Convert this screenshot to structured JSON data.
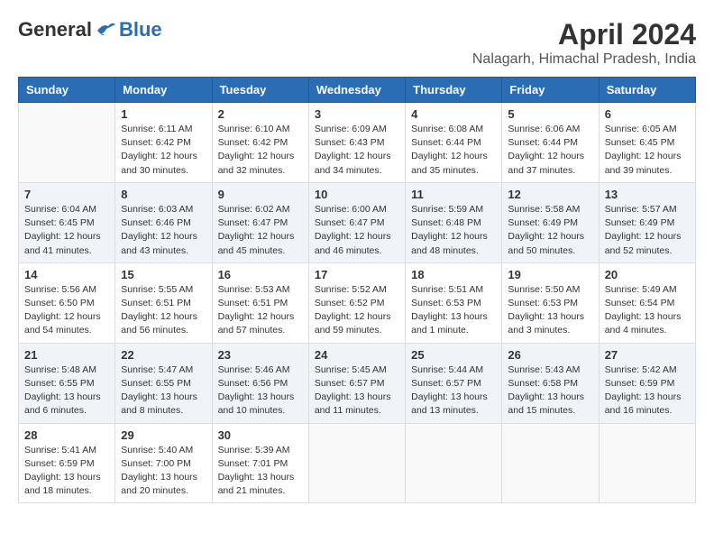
{
  "header": {
    "logo_general": "General",
    "logo_blue": "Blue",
    "title": "April 2024",
    "location": "Nalagarh, Himachal Pradesh, India"
  },
  "days_of_week": [
    "Sunday",
    "Monday",
    "Tuesday",
    "Wednesday",
    "Thursday",
    "Friday",
    "Saturday"
  ],
  "weeks": [
    [
      {
        "day": "",
        "info": ""
      },
      {
        "day": "1",
        "info": "Sunrise: 6:11 AM\nSunset: 6:42 PM\nDaylight: 12 hours\nand 30 minutes."
      },
      {
        "day": "2",
        "info": "Sunrise: 6:10 AM\nSunset: 6:42 PM\nDaylight: 12 hours\nand 32 minutes."
      },
      {
        "day": "3",
        "info": "Sunrise: 6:09 AM\nSunset: 6:43 PM\nDaylight: 12 hours\nand 34 minutes."
      },
      {
        "day": "4",
        "info": "Sunrise: 6:08 AM\nSunset: 6:44 PM\nDaylight: 12 hours\nand 35 minutes."
      },
      {
        "day": "5",
        "info": "Sunrise: 6:06 AM\nSunset: 6:44 PM\nDaylight: 12 hours\nand 37 minutes."
      },
      {
        "day": "6",
        "info": "Sunrise: 6:05 AM\nSunset: 6:45 PM\nDaylight: 12 hours\nand 39 minutes."
      }
    ],
    [
      {
        "day": "7",
        "info": "Sunrise: 6:04 AM\nSunset: 6:45 PM\nDaylight: 12 hours\nand 41 minutes."
      },
      {
        "day": "8",
        "info": "Sunrise: 6:03 AM\nSunset: 6:46 PM\nDaylight: 12 hours\nand 43 minutes."
      },
      {
        "day": "9",
        "info": "Sunrise: 6:02 AM\nSunset: 6:47 PM\nDaylight: 12 hours\nand 45 minutes."
      },
      {
        "day": "10",
        "info": "Sunrise: 6:00 AM\nSunset: 6:47 PM\nDaylight: 12 hours\nand 46 minutes."
      },
      {
        "day": "11",
        "info": "Sunrise: 5:59 AM\nSunset: 6:48 PM\nDaylight: 12 hours\nand 48 minutes."
      },
      {
        "day": "12",
        "info": "Sunrise: 5:58 AM\nSunset: 6:49 PM\nDaylight: 12 hours\nand 50 minutes."
      },
      {
        "day": "13",
        "info": "Sunrise: 5:57 AM\nSunset: 6:49 PM\nDaylight: 12 hours\nand 52 minutes."
      }
    ],
    [
      {
        "day": "14",
        "info": "Sunrise: 5:56 AM\nSunset: 6:50 PM\nDaylight: 12 hours\nand 54 minutes."
      },
      {
        "day": "15",
        "info": "Sunrise: 5:55 AM\nSunset: 6:51 PM\nDaylight: 12 hours\nand 56 minutes."
      },
      {
        "day": "16",
        "info": "Sunrise: 5:53 AM\nSunset: 6:51 PM\nDaylight: 12 hours\nand 57 minutes."
      },
      {
        "day": "17",
        "info": "Sunrise: 5:52 AM\nSunset: 6:52 PM\nDaylight: 12 hours\nand 59 minutes."
      },
      {
        "day": "18",
        "info": "Sunrise: 5:51 AM\nSunset: 6:53 PM\nDaylight: 13 hours\nand 1 minute."
      },
      {
        "day": "19",
        "info": "Sunrise: 5:50 AM\nSunset: 6:53 PM\nDaylight: 13 hours\nand 3 minutes."
      },
      {
        "day": "20",
        "info": "Sunrise: 5:49 AM\nSunset: 6:54 PM\nDaylight: 13 hours\nand 4 minutes."
      }
    ],
    [
      {
        "day": "21",
        "info": "Sunrise: 5:48 AM\nSunset: 6:55 PM\nDaylight: 13 hours\nand 6 minutes."
      },
      {
        "day": "22",
        "info": "Sunrise: 5:47 AM\nSunset: 6:55 PM\nDaylight: 13 hours\nand 8 minutes."
      },
      {
        "day": "23",
        "info": "Sunrise: 5:46 AM\nSunset: 6:56 PM\nDaylight: 13 hours\nand 10 minutes."
      },
      {
        "day": "24",
        "info": "Sunrise: 5:45 AM\nSunset: 6:57 PM\nDaylight: 13 hours\nand 11 minutes."
      },
      {
        "day": "25",
        "info": "Sunrise: 5:44 AM\nSunset: 6:57 PM\nDaylight: 13 hours\nand 13 minutes."
      },
      {
        "day": "26",
        "info": "Sunrise: 5:43 AM\nSunset: 6:58 PM\nDaylight: 13 hours\nand 15 minutes."
      },
      {
        "day": "27",
        "info": "Sunrise: 5:42 AM\nSunset: 6:59 PM\nDaylight: 13 hours\nand 16 minutes."
      }
    ],
    [
      {
        "day": "28",
        "info": "Sunrise: 5:41 AM\nSunset: 6:59 PM\nDaylight: 13 hours\nand 18 minutes."
      },
      {
        "day": "29",
        "info": "Sunrise: 5:40 AM\nSunset: 7:00 PM\nDaylight: 13 hours\nand 20 minutes."
      },
      {
        "day": "30",
        "info": "Sunrise: 5:39 AM\nSunset: 7:01 PM\nDaylight: 13 hours\nand 21 minutes."
      },
      {
        "day": "",
        "info": ""
      },
      {
        "day": "",
        "info": ""
      },
      {
        "day": "",
        "info": ""
      },
      {
        "day": "",
        "info": ""
      }
    ]
  ]
}
